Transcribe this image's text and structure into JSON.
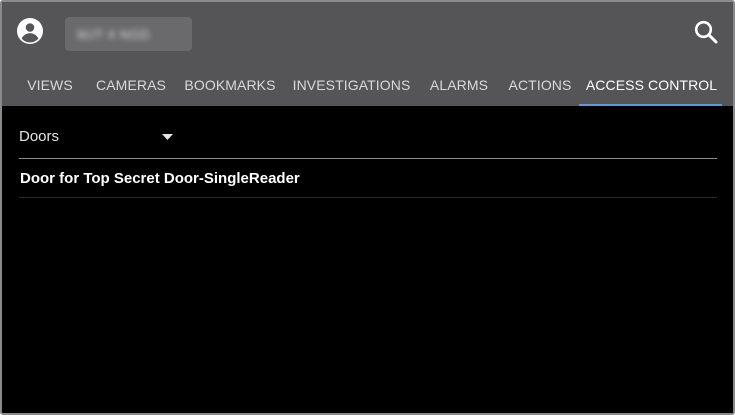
{
  "header": {
    "account_icon": "account-circle-icon",
    "server_name": "MJT 4 NGD",
    "search_icon": "search-icon"
  },
  "tabs": [
    {
      "label": "VIEWS",
      "active": false
    },
    {
      "label": "CAMERAS",
      "active": false
    },
    {
      "label": "BOOKMARKS",
      "active": false
    },
    {
      "label": "INVESTIGATIONS",
      "active": false
    },
    {
      "label": "ALARMS",
      "active": false
    },
    {
      "label": "ACTIONS",
      "active": false
    },
    {
      "label": "ACCESS CONTROL",
      "active": true
    }
  ],
  "filter": {
    "selected": "Doors",
    "icon": "dropdown-arrow-icon"
  },
  "list": {
    "items": [
      {
        "label": "Door for Top Secret Door-SingleReader"
      }
    ]
  },
  "colors": {
    "appbar": "#555557",
    "background": "#000000",
    "active_tab_indicator": "#5a9be0",
    "text_primary": "#ffffff"
  }
}
